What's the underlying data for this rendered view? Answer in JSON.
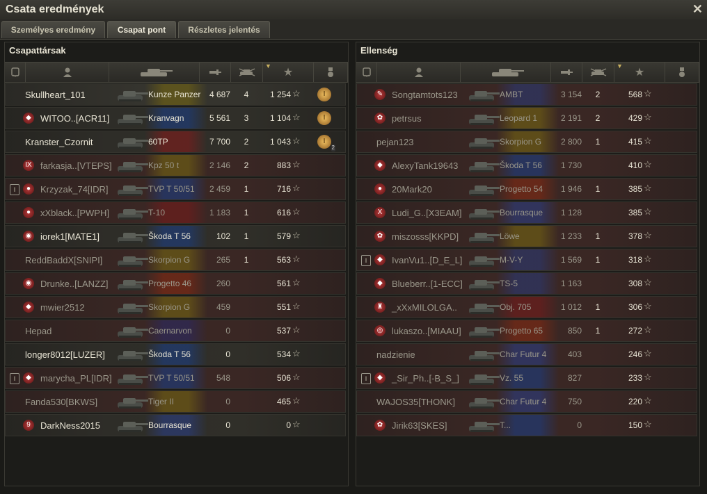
{
  "window": {
    "title": "Csata eredmények",
    "close_label": "✕"
  },
  "tabs": [
    {
      "label": "Személyes eredmény"
    },
    {
      "label": "Csapat pont"
    },
    {
      "label": "Részletes jelentés"
    }
  ],
  "team": {
    "title": "Csapattársak",
    "rows": [
      {
        "player": "Skullheart_101",
        "tank": "Kunze Panzer",
        "damage": "4 687",
        "kills": "4",
        "xp": "1 254",
        "medal": "I",
        "medal_count": "",
        "platoon": "",
        "clan": "",
        "alive": true,
        "flag": "ger",
        "style": "bright"
      },
      {
        "player": "WITOO..[ACR11]",
        "tank": "Kranvagn",
        "damage": "5 561",
        "kills": "3",
        "xp": "1 104",
        "medal": "I",
        "medal_count": "",
        "platoon": "",
        "clan": "◆",
        "alive": true,
        "flag": "swe",
        "style": "dark"
      },
      {
        "player": "Kranster_Czornit",
        "tank": "60TP",
        "damage": "7 700",
        "kills": "2",
        "xp": "1 043",
        "medal": "I",
        "medal_count": "2",
        "platoon": "",
        "clan": "",
        "alive": true,
        "flag": "pol",
        "style": "dark"
      },
      {
        "player": "farkasja..[VTEPS]",
        "tank": "Kpz 50 t",
        "damage": "2 146",
        "kills": "2",
        "xp": "883",
        "medal": "",
        "medal_count": "",
        "platoon": "",
        "clan": "IX",
        "alive": false,
        "flag": "ger",
        "style": "red"
      },
      {
        "player": "Krzyzak_74[IDR]",
        "tank": "TVP T 50/51",
        "damage": "2 459",
        "kills": "1",
        "xp": "716",
        "medal": "",
        "medal_count": "",
        "platoon": "I",
        "clan": "●",
        "alive": false,
        "flag": "cze",
        "style": "red"
      },
      {
        "player": "xXblack..[PWPH]",
        "tank": "T-10",
        "damage": "1 183",
        "kills": "1",
        "xp": "616",
        "medal": "",
        "medal_count": "",
        "platoon": "",
        "clan": "●",
        "alive": false,
        "flag": "ussr",
        "style": "red"
      },
      {
        "player": "iorek1[MATE1]",
        "tank": "Škoda T 56",
        "damage": "102",
        "kills": "1",
        "xp": "579",
        "medal": "",
        "medal_count": "",
        "platoon": "",
        "clan": "◉",
        "alive": true,
        "flag": "cze",
        "style": "dark"
      },
      {
        "player": "ReddBaddX[SNIPI]",
        "tank": "Skorpion G",
        "damage": "265",
        "kills": "1",
        "xp": "563",
        "medal": "",
        "medal_count": "",
        "platoon": "",
        "clan": "",
        "alive": false,
        "flag": "ger",
        "style": "red"
      },
      {
        "player": "Drunke..[LANZZ]",
        "tank": "Progetto 46",
        "damage": "260",
        "kills": "",
        "xp": "561",
        "medal": "",
        "medal_count": "",
        "platoon": "",
        "clan": "◉",
        "alive": false,
        "flag": "ita",
        "style": "red"
      },
      {
        "player": "mwier2512",
        "tank": "Skorpion G",
        "damage": "459",
        "kills": "",
        "xp": "551",
        "medal": "",
        "medal_count": "",
        "platoon": "",
        "clan": "◆",
        "alive": false,
        "flag": "ger",
        "style": "red"
      },
      {
        "player": "Hepad",
        "tank": "Caernarvon",
        "damage": "0",
        "kills": "",
        "xp": "537",
        "medal": "",
        "medal_count": "",
        "platoon": "",
        "clan": "",
        "alive": false,
        "flag": "uk",
        "style": "red"
      },
      {
        "player": "longer8012[LUZER]",
        "tank": "Škoda T 56",
        "damage": "0",
        "kills": "",
        "xp": "534",
        "medal": "",
        "medal_count": "",
        "platoon": "",
        "clan": "",
        "alive": true,
        "flag": "cze",
        "style": "dark"
      },
      {
        "player": "marycha_PL[IDR]",
        "tank": "TVP T 50/51",
        "damage": "548",
        "kills": "",
        "xp": "506",
        "medal": "",
        "medal_count": "",
        "platoon": "I",
        "clan": "◆",
        "alive": false,
        "flag": "cze",
        "style": "red"
      },
      {
        "player": "Fanda530[BKWS]",
        "tank": "Tiger II",
        "damage": "0",
        "kills": "",
        "xp": "465",
        "medal": "",
        "medal_count": "",
        "platoon": "",
        "clan": "",
        "alive": false,
        "flag": "ger",
        "style": "red"
      },
      {
        "player": "DarkNess2015",
        "tank": "Bourrasque",
        "damage": "0",
        "kills": "",
        "xp": "0",
        "medal": "",
        "medal_count": "",
        "platoon": "",
        "clan": "9",
        "alive": true,
        "flag": "fra",
        "style": "dark"
      }
    ]
  },
  "enemy": {
    "title": "Ellenség",
    "rows": [
      {
        "player": "Songtamtots123",
        "tank": "AMBT",
        "damage": "3 154",
        "kills": "2",
        "xp": "568",
        "medal": "",
        "medal_count": "",
        "platoon": "",
        "clan": "✎",
        "alive": false,
        "flag": "usa",
        "style": "red"
      },
      {
        "player": "petrsus",
        "tank": "Leopard 1",
        "damage": "2 191",
        "kills": "2",
        "xp": "429",
        "medal": "",
        "medal_count": "",
        "platoon": "",
        "clan": "✿",
        "alive": false,
        "flag": "ger",
        "style": "red"
      },
      {
        "player": "pejan123",
        "tank": "Skorpion G",
        "damage": "2 800",
        "kills": "1",
        "xp": "415",
        "medal": "",
        "medal_count": "",
        "platoon": "",
        "clan": "",
        "alive": false,
        "flag": "ger",
        "style": "red"
      },
      {
        "player": "AlexyTank19643",
        "tank": "Škoda T 56",
        "damage": "1 730",
        "kills": "",
        "xp": "410",
        "medal": "",
        "medal_count": "",
        "platoon": "",
        "clan": "◆",
        "alive": false,
        "flag": "cze",
        "style": "red"
      },
      {
        "player": "20Mark20",
        "tank": "Progetto 54",
        "damage": "1 946",
        "kills": "1",
        "xp": "385",
        "medal": "",
        "medal_count": "",
        "platoon": "",
        "clan": "●",
        "alive": false,
        "flag": "ita",
        "style": "red"
      },
      {
        "player": "Ludi_G..[X3EAM]",
        "tank": "Bourrasque",
        "damage": "1 128",
        "kills": "",
        "xp": "385",
        "medal": "",
        "medal_count": "",
        "platoon": "",
        "clan": "X",
        "alive": false,
        "flag": "fra",
        "style": "red"
      },
      {
        "player": "miszosss[KKPD]",
        "tank": "Löwe",
        "damage": "1 233",
        "kills": "1",
        "xp": "378",
        "medal": "",
        "medal_count": "",
        "platoon": "",
        "clan": "✿",
        "alive": false,
        "flag": "ger",
        "style": "red"
      },
      {
        "player": "IvanVu1..[D_E_L]",
        "tank": "M-V-Y",
        "damage": "1 569",
        "kills": "1",
        "xp": "318",
        "medal": "",
        "medal_count": "",
        "platoon": "I",
        "clan": "◆",
        "alive": false,
        "flag": "usa",
        "style": "red"
      },
      {
        "player": "Blueberr..[1-ECC]",
        "tank": "TS-5",
        "damage": "1 163",
        "kills": "",
        "xp": "308",
        "medal": "",
        "medal_count": "",
        "platoon": "",
        "clan": "◆",
        "alive": false,
        "flag": "usa",
        "style": "red"
      },
      {
        "player": "_xXxMILOLGA..",
        "tank": "Obj. 705",
        "damage": "1 012",
        "kills": "1",
        "xp": "306",
        "medal": "",
        "medal_count": "",
        "platoon": "",
        "clan": "♜",
        "alive": false,
        "flag": "ussr",
        "style": "red"
      },
      {
        "player": "lukaszo..[MIAAU]",
        "tank": "Progetto 65",
        "damage": "850",
        "kills": "1",
        "xp": "272",
        "medal": "",
        "medal_count": "",
        "platoon": "",
        "clan": "◎",
        "alive": false,
        "flag": "ita",
        "style": "red"
      },
      {
        "player": "nadzienie",
        "tank": "Char Futur 4",
        "damage": "403",
        "kills": "",
        "xp": "246",
        "medal": "",
        "medal_count": "",
        "platoon": "",
        "clan": "",
        "alive": false,
        "flag": "fra",
        "style": "red"
      },
      {
        "player": "_Sir_Ph..[-B_S_]",
        "tank": "Vz. 55",
        "damage": "827",
        "kills": "",
        "xp": "233",
        "medal": "",
        "medal_count": "",
        "platoon": "I",
        "clan": "◆",
        "alive": false,
        "flag": "cze",
        "style": "red"
      },
      {
        "player": "WAJOS35[THONK]",
        "tank": "Char Futur 4",
        "damage": "750",
        "kills": "",
        "xp": "220",
        "medal": "",
        "medal_count": "",
        "platoon": "",
        "clan": "",
        "alive": false,
        "flag": "fra",
        "style": "red"
      },
      {
        "player": "Jirik63[SKES]",
        "tank": "T...",
        "damage": "0",
        "kills": "",
        "xp": "150",
        "medal": "",
        "medal_count": "",
        "platoon": "",
        "clan": "✿",
        "alive": false,
        "flag": "cze",
        "style": "red"
      }
    ]
  },
  "colors": {
    "ger": "#7a6a10",
    "swe": "#1a3f8a",
    "pol": "#8a1a1a",
    "cze": "#1a3f8a",
    "ussr": "#7a1a1a",
    "ita": "#8a2a10",
    "uk": "#2a2a6a",
    "fra": "#2a3f8a",
    "usa": "#2a3a7a"
  }
}
